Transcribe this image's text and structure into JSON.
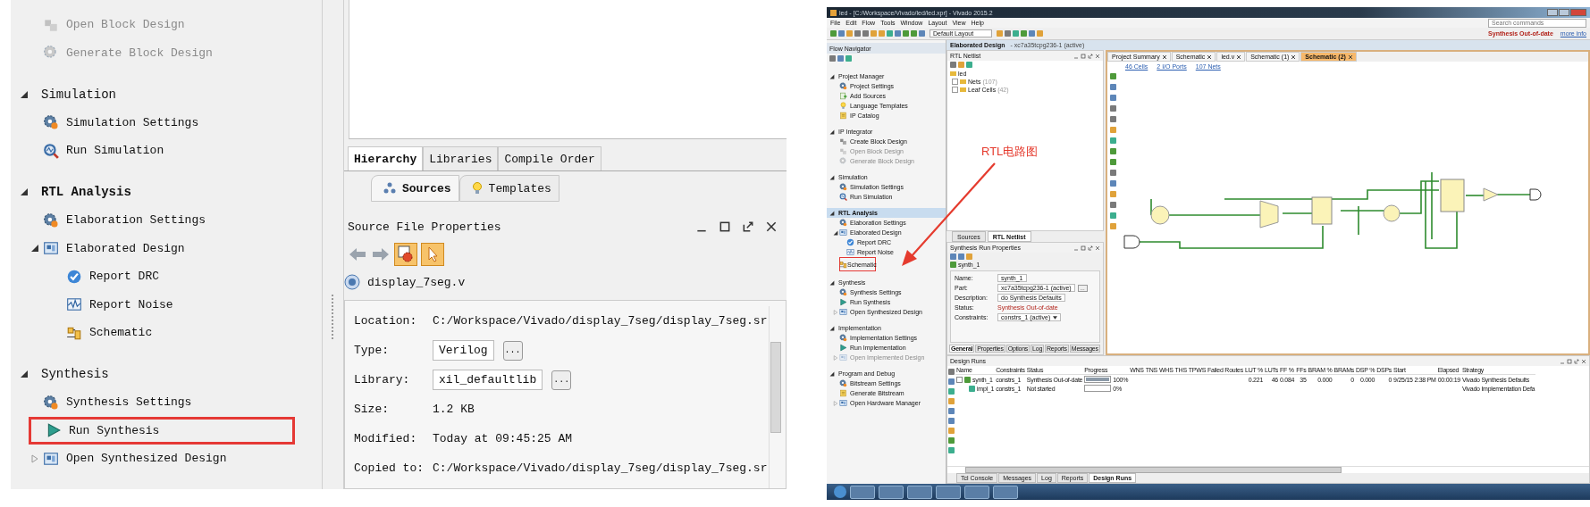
{
  "left_screenshot": {
    "flow_navigator": {
      "partial_items": [
        {
          "label": "Open Block Design",
          "disabled": true,
          "annotated": false
        },
        {
          "label": "Generate Block Design",
          "disabled": true,
          "annotated": false
        }
      ],
      "sections": [
        {
          "label": "Simulation",
          "selected": false,
          "expanded": true,
          "items": [
            {
              "label": "Simulation Settings",
              "disabled": false,
              "annotated": false
            },
            {
              "label": "Run Simulation",
              "disabled": false,
              "annotated": false
            }
          ]
        },
        {
          "label": "RTL Analysis",
          "selected": true,
          "expanded": true,
          "items": [
            {
              "label": "Elaboration Settings",
              "disabled": false,
              "annotated": false
            },
            {
              "label": "Elaborated Design",
              "disabled": false,
              "annotated": false,
              "expanded": true,
              "children": [
                {
                  "label": "Report DRC",
                  "disabled": false,
                  "annotated": false
                },
                {
                  "label": "Report Noise",
                  "disabled": false,
                  "annotated": false
                },
                {
                  "label": "Schematic",
                  "disabled": false,
                  "annotated": false
                }
              ]
            }
          ]
        },
        {
          "label": "Synthesis",
          "selected": false,
          "expanded": true,
          "items": [
            {
              "label": "Synthesis Settings",
              "disabled": false,
              "annotated": false
            },
            {
              "label": "Run Synthesis",
              "disabled": false,
              "annotated": true
            },
            {
              "label": "Open Synthesized Design",
              "disabled": false,
              "annotated": false,
              "expanded": false
            }
          ]
        }
      ]
    },
    "hierarchy_tabs": [
      {
        "label": "Hierarchy",
        "selected": true
      },
      {
        "label": "Libraries",
        "selected": false
      },
      {
        "label": "Compile Order",
        "selected": false
      }
    ],
    "source_tabs": [
      {
        "label": "Sources",
        "selected": true
      },
      {
        "label": "Templates",
        "selected": false
      }
    ],
    "source_file_properties": {
      "title": "Source File Properties",
      "file": "display_7seg.v",
      "fields": [
        {
          "label": "Location:",
          "value": "C:/Workspace/Vivado/display_7seg/display_7seg.sr",
          "kind": "text"
        },
        {
          "label": "Type:",
          "value": "Verilog",
          "kind": "choice",
          "button": "..."
        },
        {
          "label": "Library:",
          "value": "xil_defaultlib",
          "kind": "choice",
          "button": "..."
        },
        {
          "label": "Size:",
          "value": "1.2 KB",
          "kind": "text"
        },
        {
          "label": "Modified:",
          "value": "Today at 09:45:25 AM",
          "kind": "text"
        },
        {
          "label": "Copied to:",
          "value": "C:/Workspace/Vivado/display_7seg/display_7seg.sr",
          "kind": "text"
        }
      ]
    }
  },
  "right_screenshot": {
    "title": "led - [C:/Workspace/Vivado/led/led.xpr] - Vivado 2015.2",
    "menu": [
      "File",
      "Edit",
      "Flow",
      "Tools",
      "Window",
      "Layout",
      "View",
      "Help"
    ],
    "search": {
      "placeholder": "Search commands"
    },
    "layout_dropdown": "Default Layout",
    "status": "Synthesis Out-of-date",
    "status_link": "more info",
    "flow_navigator": {
      "title": "Flow Navigator",
      "sections": [
        {
          "label": "Project Manager",
          "selected": false,
          "expanded": true,
          "items": [
            {
              "label": "Project Settings",
              "disabled": false,
              "annotated": false
            },
            {
              "label": "Add Sources",
              "disabled": false,
              "annotated": false
            },
            {
              "label": "Language Templates",
              "disabled": false,
              "annotated": false
            },
            {
              "label": "IP Catalog",
              "disabled": false,
              "annotated": false
            }
          ]
        },
        {
          "label": "IP Integrator",
          "selected": false,
          "expanded": true,
          "items": [
            {
              "label": "Create Block Design",
              "disabled": false,
              "annotated": false
            },
            {
              "label": "Open Block Design",
              "disabled": true,
              "annotated": false
            },
            {
              "label": "Generate Block Design",
              "disabled": true,
              "annotated": false
            }
          ]
        },
        {
          "label": "Simulation",
          "selected": false,
          "expanded": true,
          "items": [
            {
              "label": "Simulation Settings",
              "disabled": false,
              "annotated": false
            },
            {
              "label": "Run Simulation",
              "disabled": false,
              "annotated": false
            }
          ]
        },
        {
          "label": "RTL Analysis",
          "selected": true,
          "expanded": true,
          "items": [
            {
              "label": "Elaboration Settings",
              "disabled": false,
              "annotated": false
            },
            {
              "label": "Elaborated Design",
              "disabled": false,
              "annotated": false,
              "expanded": true,
              "children": [
                {
                  "label": "Report DRC",
                  "disabled": false,
                  "annotated": false
                },
                {
                  "label": "Report Noise",
                  "disabled": false,
                  "annotated": false
                },
                {
                  "label": "Schematic",
                  "disabled": false,
                  "annotated": true
                }
              ]
            }
          ]
        },
        {
          "label": "Synthesis",
          "selected": false,
          "expanded": true,
          "items": [
            {
              "label": "Synthesis Settings",
              "disabled": false,
              "annotated": false
            },
            {
              "label": "Run Synthesis",
              "disabled": false,
              "annotated": false
            },
            {
              "label": "Open Synthesized Design",
              "disabled": false,
              "annotated": false,
              "expanded": false
            }
          ]
        },
        {
          "label": "Implementation",
          "selected": false,
          "expanded": true,
          "items": [
            {
              "label": "Implementation Settings",
              "disabled": false,
              "annotated": false
            },
            {
              "label": "Run Implementation",
              "disabled": false,
              "annotated": false
            },
            {
              "label": "Open Implemented Design",
              "disabled": true,
              "annotated": false,
              "expanded": false
            }
          ]
        },
        {
          "label": "Program and Debug",
          "selected": false,
          "expanded": true,
          "items": [
            {
              "label": "Bitstream Settings",
              "disabled": false,
              "annotated": false
            },
            {
              "label": "Generate Bitstream",
              "disabled": false,
              "annotated": false
            },
            {
              "label": "Open Hardware Manager",
              "disabled": false,
              "annotated": false,
              "expanded": false
            }
          ]
        }
      ]
    },
    "design_header": {
      "title": "Elaborated Design",
      "part": "- xc7a35tcpg236-1 (active)"
    },
    "netlist": {
      "title": "RTL Netlist",
      "root": "led",
      "children": [
        {
          "label": "Nets",
          "count": "(107)"
        },
        {
          "label": "Leaf Cells",
          "count": "(42)"
        }
      ]
    },
    "annotation": "RTL电路图",
    "netlist_tabs": [
      {
        "label": "Sources",
        "selected": false
      },
      {
        "label": "RTL Netlist",
        "selected": true
      }
    ],
    "run_properties": {
      "title": "Synthesis Run Properties",
      "run": "synth_1",
      "fields": [
        {
          "label": "Name:",
          "value": "synth_1",
          "kind": "field"
        },
        {
          "label": "Part:",
          "value": "xc7a35tcpg236-1 (active)",
          "kind": "part",
          "button": "..."
        },
        {
          "label": "Description:",
          "value": "do Synthesis Defaults",
          "kind": "field"
        },
        {
          "label": "Status:",
          "value": "Synthesis Out-of-date",
          "kind": "status"
        },
        {
          "label": "Constraints:",
          "value": "constrs_1 (active)",
          "kind": "dropdown"
        }
      ],
      "tabs": [
        {
          "label": "General",
          "selected": true
        },
        {
          "label": "Properties",
          "selected": false
        },
        {
          "label": "Options",
          "selected": false
        },
        {
          "label": "Log",
          "selected": false
        },
        {
          "label": "Reports",
          "selected": false
        },
        {
          "label": "Messages",
          "selected": false
        }
      ]
    },
    "editor_tabs": [
      {
        "label": "Project Summary",
        "selected": false
      },
      {
        "label": "Schematic",
        "selected": false
      },
      {
        "label": "led.v",
        "selected": false
      },
      {
        "label": "Schematic (1)",
        "selected": false
      },
      {
        "label": "Schematic (2)",
        "selected": true
      }
    ],
    "schematic_links": [
      "46 Cells",
      "2 I/O Ports",
      "107 Nets"
    ],
    "design_runs": {
      "title": "Design Runs",
      "columns": [
        "Name",
        "Constraints",
        "Status",
        "Progress",
        "WNS",
        "TNS",
        "WHS",
        "THS",
        "TPWS",
        "Failed Routes",
        "LUT %",
        "LUTs",
        "FF %",
        "FFs",
        "BRAM %",
        "BRAMs",
        "DSP %",
        "DSPs",
        "Start",
        "Elapsed",
        "Strategy"
      ],
      "rows": [
        {
          "expanded": true,
          "level": 1,
          "cells": [
            "synth_1",
            "constrs_1",
            "Synthesis Out-of-date",
            "100%",
            "",
            "",
            "",
            "",
            "",
            "",
            "0.221",
            "46",
            "0.084",
            "35",
            "0.000",
            "0",
            "0.000",
            "0",
            "9/25/15 2:38 PM",
            "00:00:19",
            "Vivado Synthesis Defaults"
          ]
        },
        {
          "cells": [
            "impl_1",
            "constrs_1",
            "Not started",
            "0%",
            "",
            "",
            "",
            "",
            "",
            "",
            "",
            "",
            "",
            "",
            "",
            "",
            "",
            "",
            "",
            "",
            "Vivado Implementation Defa"
          ]
        }
      ]
    },
    "bottom_tabs": [
      {
        "label": "Tcl Console",
        "selected": false
      },
      {
        "label": "Messages",
        "selected": false
      },
      {
        "label": "Log",
        "selected": false
      },
      {
        "label": "Reports",
        "selected": false
      },
      {
        "label": "Design Runs",
        "selected": true
      }
    ]
  }
}
